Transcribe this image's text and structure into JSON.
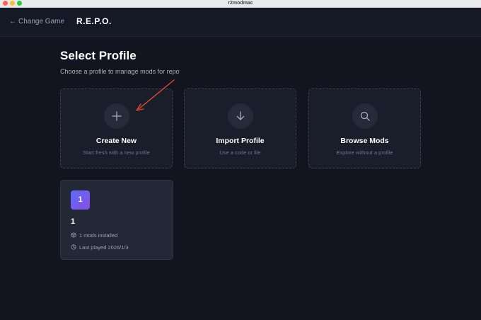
{
  "window": {
    "title": "r2modmac"
  },
  "header": {
    "back_arrow": "←",
    "back_label": "Change Game",
    "game_title": "R.E.P.O."
  },
  "page": {
    "title": "Select Profile",
    "subtitle": "Choose a profile to manage mods for repo"
  },
  "options": [
    {
      "title": "Create New",
      "desc": "Start fresh with a new profile",
      "icon": "plus-icon"
    },
    {
      "title": "Import Profile",
      "desc": "Use a code or file",
      "icon": "download-arrow-icon"
    },
    {
      "title": "Browse Mods",
      "desc": "Explore without a profile",
      "icon": "search-icon"
    }
  ],
  "profiles": [
    {
      "avatar_text": "1",
      "name": "1",
      "mods_installed": "1 mods installed",
      "last_played": "Last played 2026/1/3"
    }
  ],
  "colors": {
    "background": "#12151f",
    "card": "#1a1e2b",
    "accent_gradient_start": "#5b6cf5",
    "accent_gradient_end": "#8a4de8",
    "annotation_arrow": "#e0492b"
  }
}
